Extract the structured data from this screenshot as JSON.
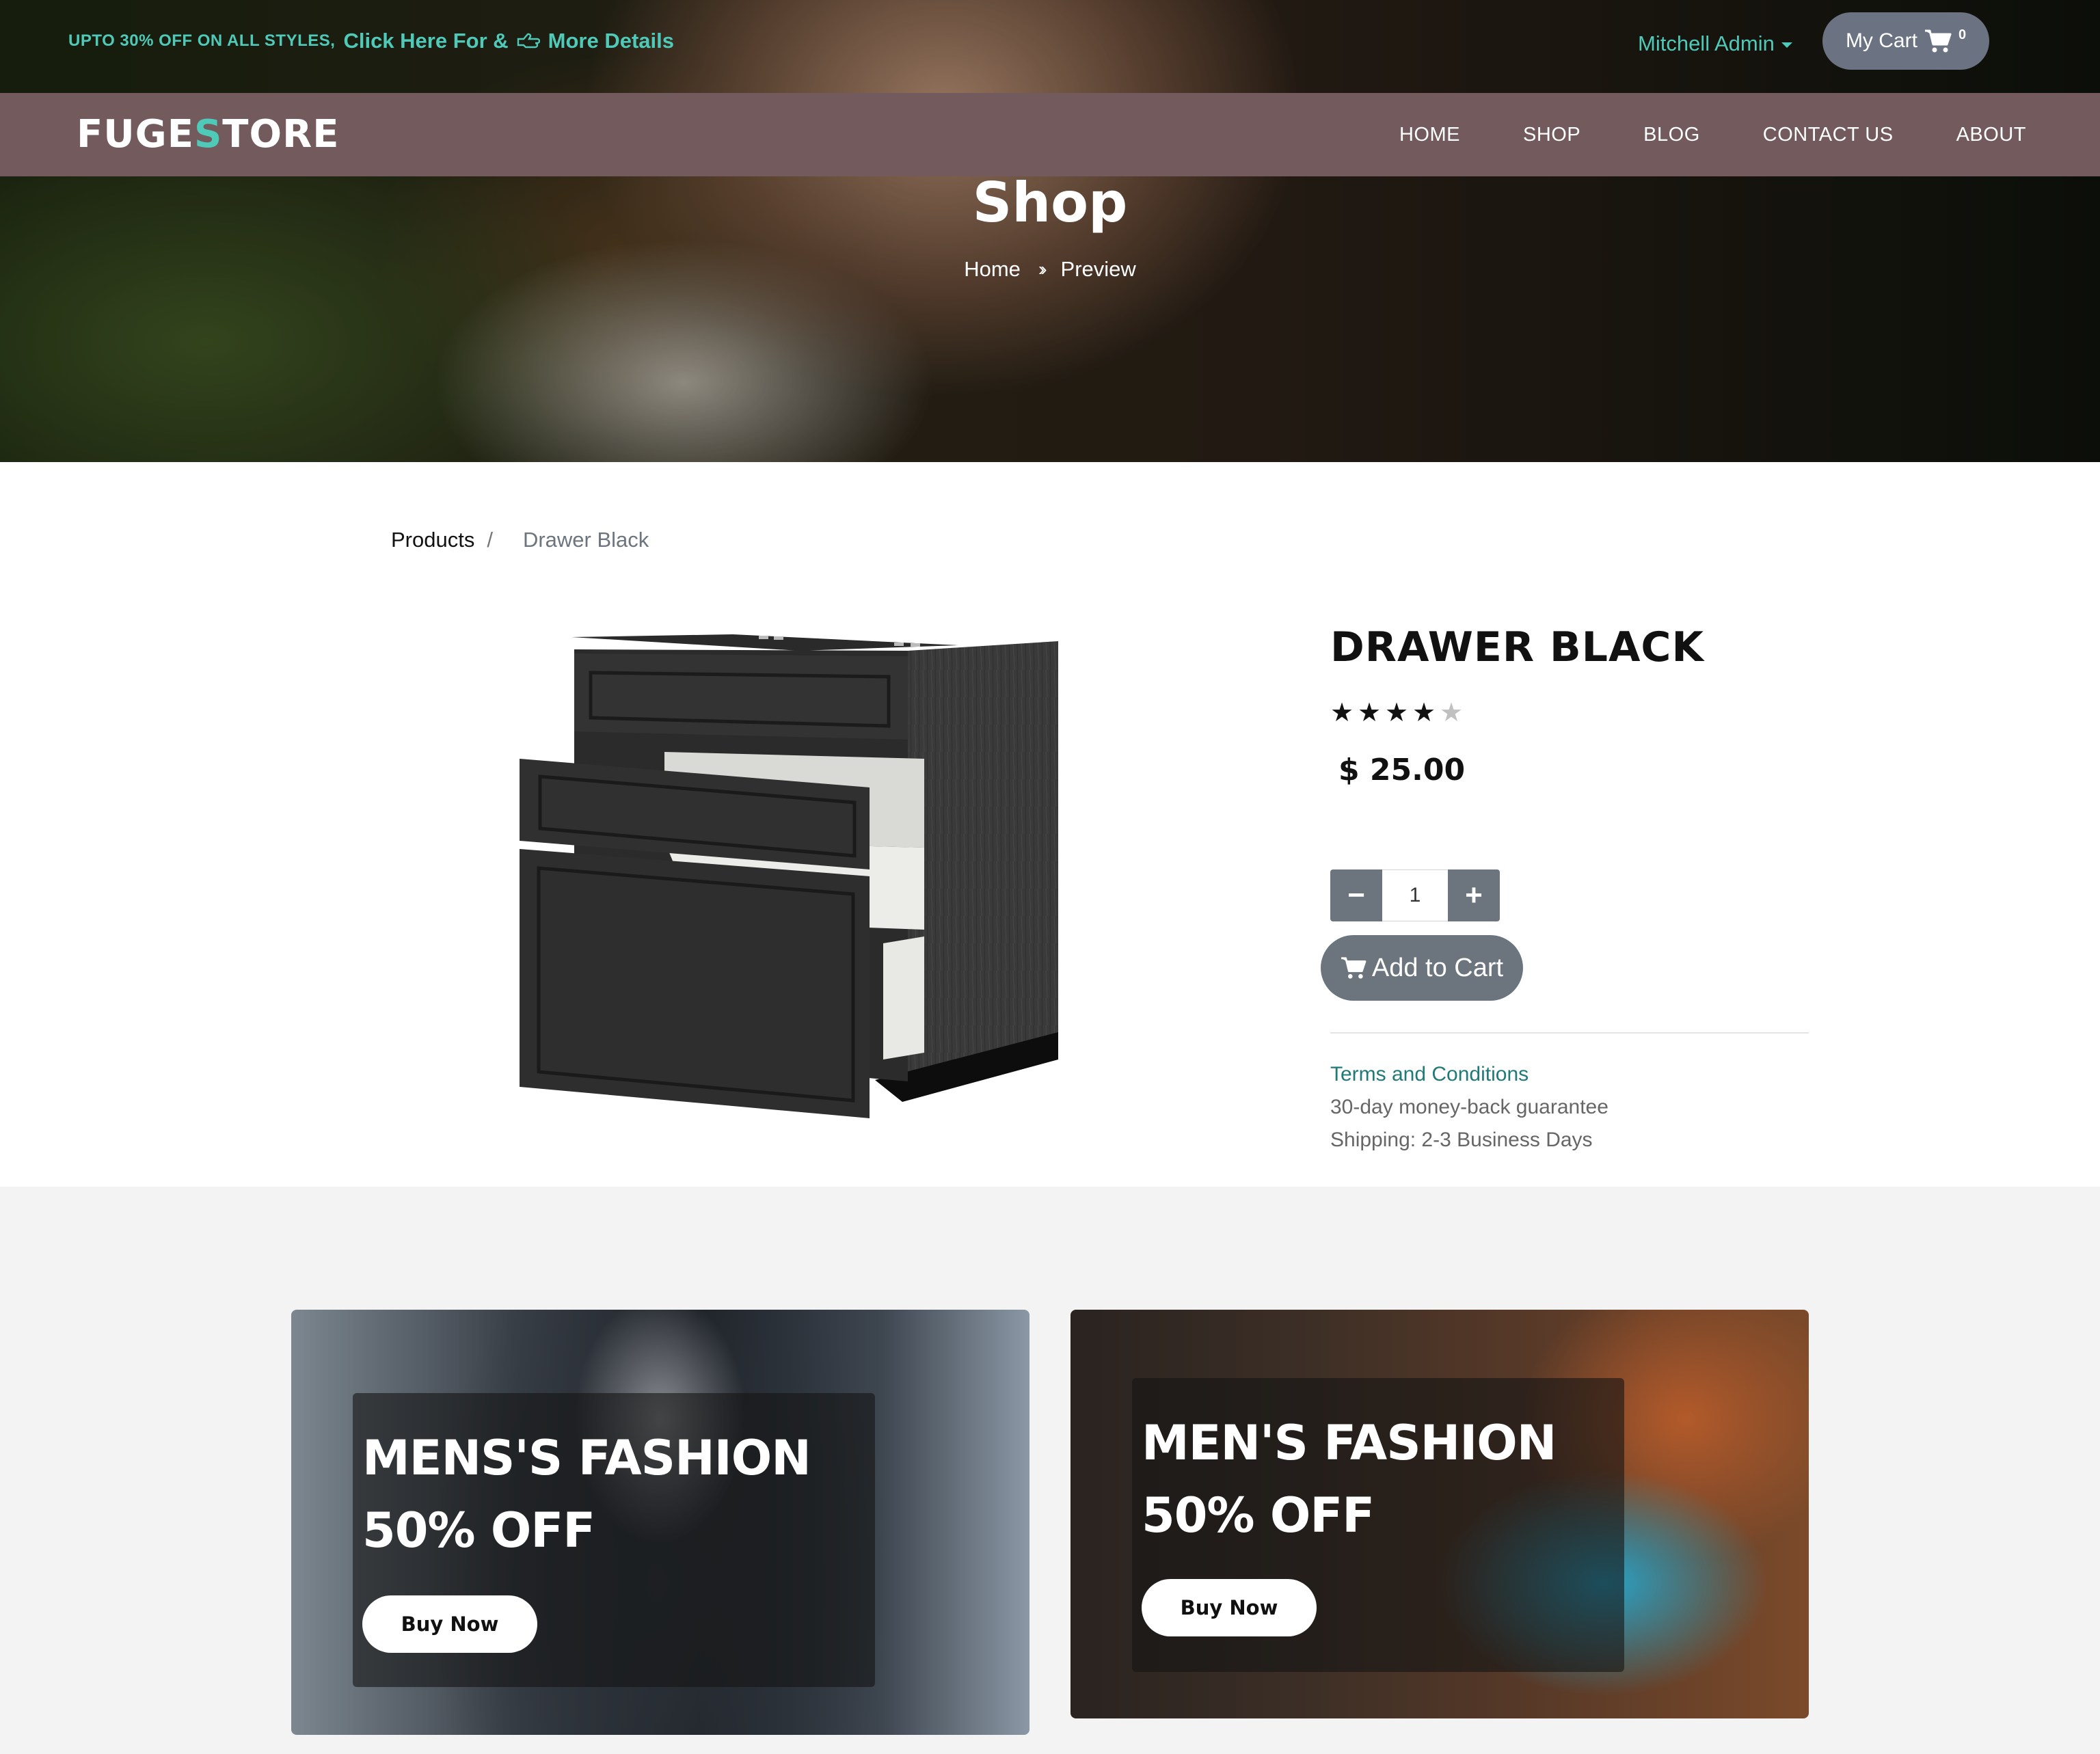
{
  "promo": {
    "text": "UPTO 30% OFF ON ALL STYLES,",
    "link_1": "Click Here For &",
    "link_2": "More Details"
  },
  "user": {
    "name": "Mitchell Admin"
  },
  "cart": {
    "label": "My Cart",
    "count": "0"
  },
  "brand": {
    "prefix": "FUGE",
    "accent": "S",
    "suffix": "TORE",
    "accent_color": "#4fc9b8"
  },
  "nav": {
    "items": [
      "HOME",
      "SHOP",
      "BLOG",
      "CONTACT US",
      "ABOUT"
    ]
  },
  "hero": {
    "title": "Shop",
    "crumb_home": "Home",
    "crumb_current": "Preview"
  },
  "breadcrumb": {
    "parent": "Products",
    "separator": "/",
    "current": "Drawer Black"
  },
  "product": {
    "title": "DRAWER BLACK",
    "rating": 4,
    "rating_max": 5,
    "price": "$ 25.00",
    "quantity": "1",
    "add_to_cart_label": "Add to Cart",
    "terms_link": "Terms and Conditions",
    "guarantee": "30-day money-back guarantee",
    "shipping": "Shipping: 2-3 Business Days"
  },
  "banners": [
    {
      "title": "MENS'S FASHION",
      "subtitle": "50% OFF",
      "button": "Buy Now"
    },
    {
      "title": "MEN'S FASHION",
      "subtitle": "50% OFF",
      "button": "Buy Now"
    }
  ],
  "colors": {
    "accent": "#4fc9b8",
    "navbar": "#735a5c",
    "button": "#6c757d",
    "link": "#1f7a78"
  }
}
